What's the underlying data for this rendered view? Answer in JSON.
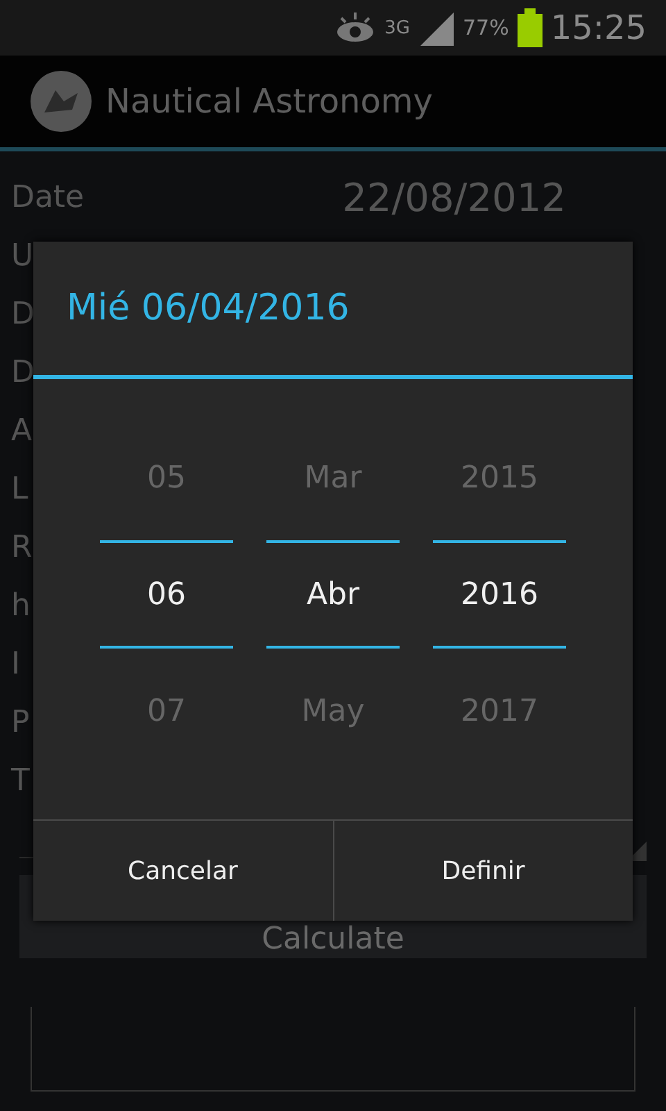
{
  "status_bar": {
    "network": "3G",
    "battery_percent": "77%",
    "time": "15:25"
  },
  "action_bar": {
    "title": "Nautical Astronomy"
  },
  "form": {
    "rows": [
      {
        "label": "Date",
        "value": "22/08/2012"
      },
      {
        "label": "U"
      },
      {
        "label": "D"
      },
      {
        "label": "D"
      },
      {
        "label": "A"
      },
      {
        "label": "L"
      },
      {
        "label": "R"
      },
      {
        "label": "h"
      },
      {
        "label": "I"
      },
      {
        "label": "P"
      },
      {
        "label": "T"
      }
    ],
    "calculate_button": "Calculate"
  },
  "dialog": {
    "title": "Mié 06/04/2016",
    "columns": [
      {
        "items": [
          {
            "text": "05",
            "selected": false
          },
          {
            "text": "06",
            "selected": true
          },
          {
            "text": "07",
            "selected": false
          }
        ]
      },
      {
        "items": [
          {
            "text": "Mar",
            "selected": false
          },
          {
            "text": "Abr",
            "selected": true
          },
          {
            "text": "May",
            "selected": false
          }
        ]
      },
      {
        "items": [
          {
            "text": "2015",
            "selected": false
          },
          {
            "text": "2016",
            "selected": true
          },
          {
            "text": "2017",
            "selected": false
          }
        ]
      }
    ],
    "buttons": [
      "Cancelar",
      "Definir"
    ]
  }
}
